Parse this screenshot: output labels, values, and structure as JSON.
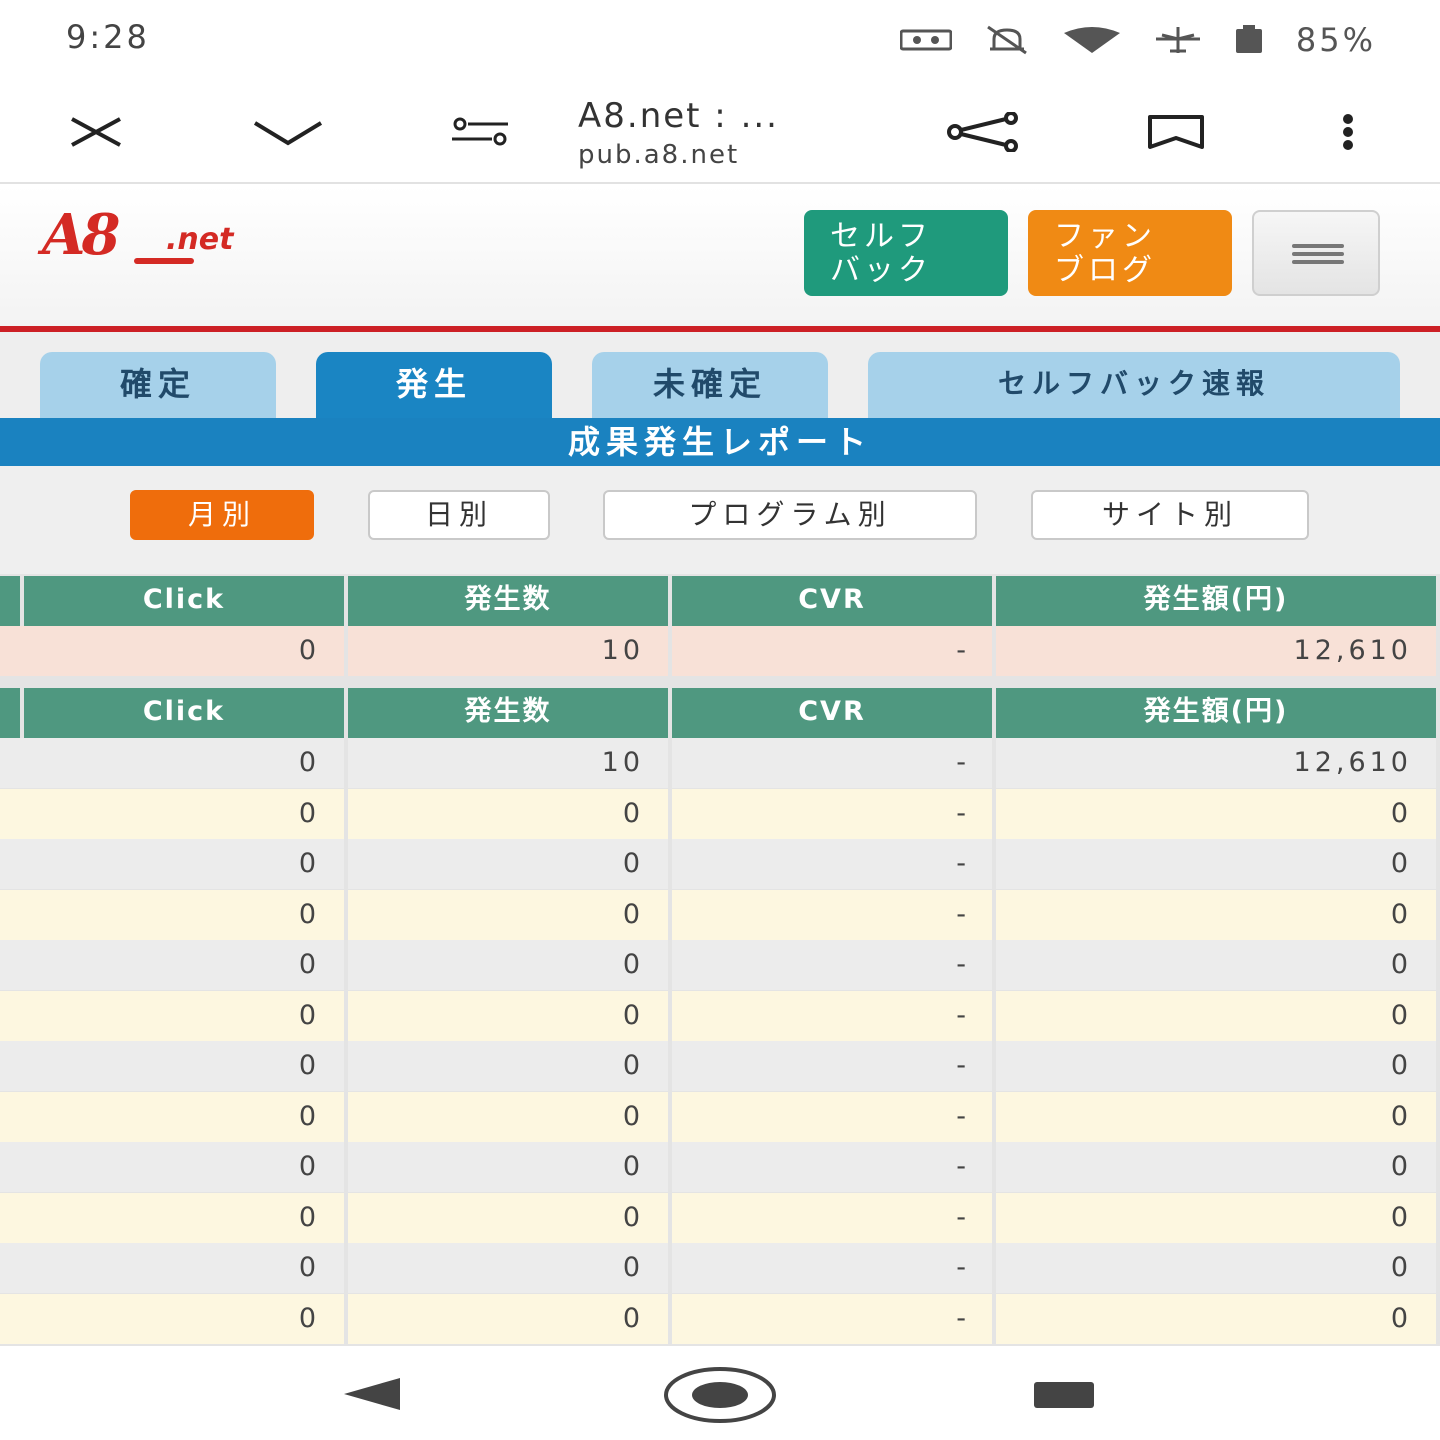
{
  "status": {
    "time": "9:28",
    "battery": "85%"
  },
  "browser": {
    "title": "A8.net : ...",
    "url": "pub.a8.net"
  },
  "header": {
    "selfback_label": "セルフ\nバック",
    "fanblog_label": "ファン\nブログ"
  },
  "tabs": [
    {
      "label": "確定"
    },
    {
      "label": "発生"
    },
    {
      "label": "未確定"
    },
    {
      "label": "セルフバック速報"
    }
  ],
  "report_title": "成果発生レポート",
  "filters": [
    {
      "label": "月別"
    },
    {
      "label": "日別"
    },
    {
      "label": "プログラム別"
    },
    {
      "label": "サイト別"
    }
  ],
  "columns": [
    "Click",
    "発生数",
    "CVR",
    "発生額(円)"
  ],
  "summary": {
    "click": "0",
    "count": "10",
    "cvr": "-",
    "amount": "12,610"
  },
  "rows": [
    {
      "click": "0",
      "count": "10",
      "cvr": "-",
      "amount": "12,610"
    },
    {
      "click": "0",
      "count": "0",
      "cvr": "-",
      "amount": "0"
    },
    {
      "click": "0",
      "count": "0",
      "cvr": "-",
      "amount": "0"
    },
    {
      "click": "0",
      "count": "0",
      "cvr": "-",
      "amount": "0"
    },
    {
      "click": "0",
      "count": "0",
      "cvr": "-",
      "amount": "0"
    },
    {
      "click": "0",
      "count": "0",
      "cvr": "-",
      "amount": "0"
    },
    {
      "click": "0",
      "count": "0",
      "cvr": "-",
      "amount": "0"
    },
    {
      "click": "0",
      "count": "0",
      "cvr": "-",
      "amount": "0"
    },
    {
      "click": "0",
      "count": "0",
      "cvr": "-",
      "amount": "0"
    },
    {
      "click": "0",
      "count": "0",
      "cvr": "-",
      "amount": "0"
    },
    {
      "click": "0",
      "count": "0",
      "cvr": "-",
      "amount": "0"
    },
    {
      "click": "0",
      "count": "0",
      "cvr": "-",
      "amount": "0"
    }
  ],
  "colors": {
    "header_green": "#4f9880",
    "tab_active": "#1a85c3",
    "tab_inactive": "#a6d1ea",
    "filter_active": "#ef6d0c",
    "brand_red": "#d42a24"
  }
}
